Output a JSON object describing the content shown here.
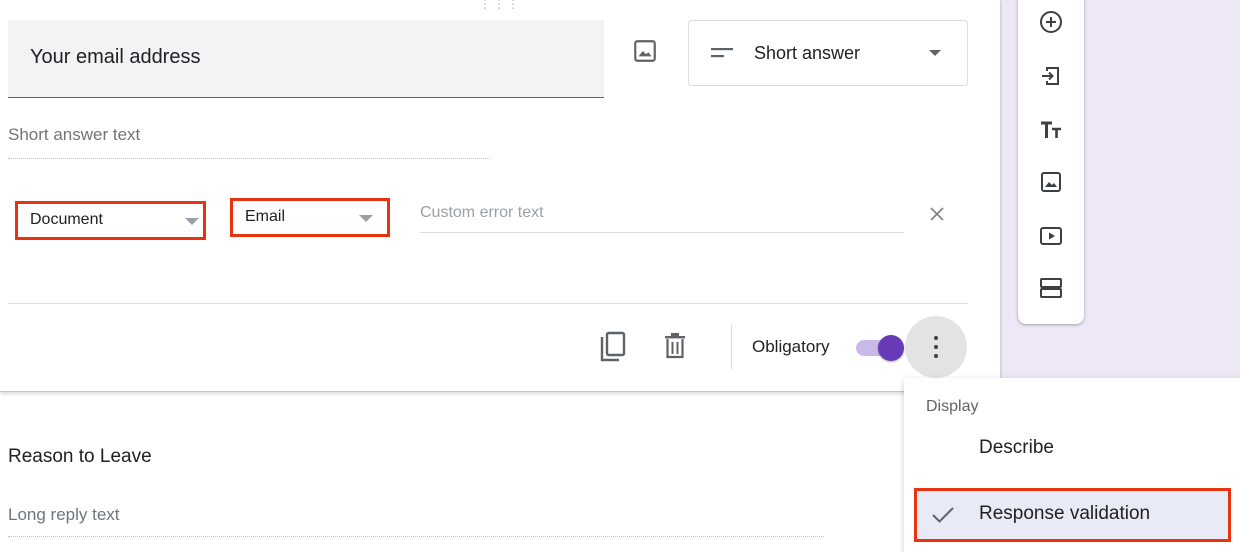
{
  "question": {
    "title": "Your email address",
    "type_label": "Short answer",
    "answer_placeholder": "Short answer text",
    "validation": {
      "category": "Document",
      "rule": "Email",
      "error_placeholder": "Custom error text"
    },
    "footer": {
      "required_label": "Obligatory",
      "required_on": true
    }
  },
  "menu": {
    "heading": "Display",
    "items": [
      {
        "label": "Describe",
        "checked": false
      },
      {
        "label": "Response validation",
        "checked": true
      }
    ]
  },
  "toolbar": {
    "icons": [
      "add-question-icon",
      "import-questions-icon",
      "add-title-icon",
      "add-image-icon",
      "add-video-icon",
      "add-section-icon"
    ]
  },
  "question2": {
    "title": "Reason to Leave",
    "answer_placeholder": "Long reply text"
  },
  "colors": {
    "accent": "#673ab7",
    "highlight": "#e8330f",
    "background_strip": "#ede7f6"
  }
}
